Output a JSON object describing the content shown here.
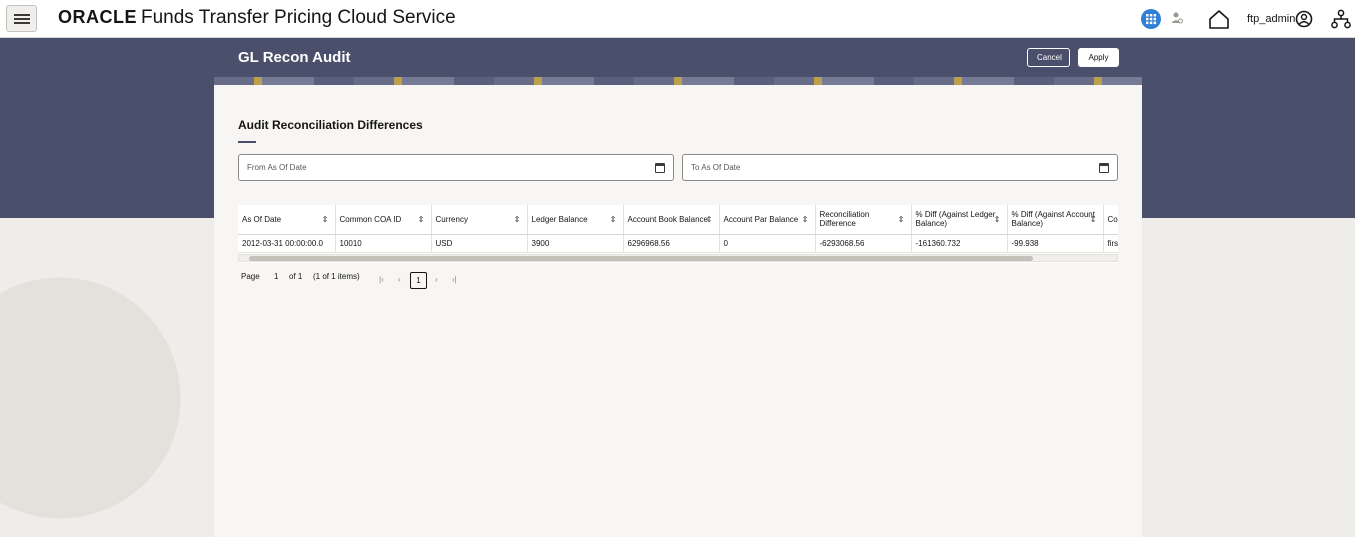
{
  "header": {
    "logo": "ORACLE",
    "product": "Funds Transfer Pricing Cloud Service",
    "user": "ftp_admin"
  },
  "page": {
    "title": "GL Recon Audit",
    "cancel_label": "Cancel",
    "apply_label": "Apply"
  },
  "section": {
    "title": "Audit Reconciliation Differences",
    "from_date_placeholder": "From As Of Date",
    "to_date_placeholder": "To As Of Date"
  },
  "table": {
    "columns": [
      "As Of Date",
      "Common COA ID",
      "Currency",
      "Ledger Balance",
      "Account Book Balance",
      "Account Par Balance",
      "Reconciliation Difference",
      "% Diff (Against Ledger Balance)",
      "% Diff (Against Account Balance)",
      "Co"
    ],
    "rows": [
      [
        "2012-03-31 00:00:00.0",
        "10010",
        "USD",
        "3900",
        "6296968.56",
        "0",
        "-6293068.56",
        "-161360.732",
        "-99.938",
        "firs"
      ]
    ]
  },
  "pager": {
    "page_label": "Page",
    "page_value": "1",
    "of_label": "of 1",
    "items_label": "(1 of 1 items)",
    "current_page": "1"
  },
  "colors": {
    "banner": "#4a4f6b",
    "panel": "#f7f6f4",
    "accent": "#2f7fd6"
  }
}
